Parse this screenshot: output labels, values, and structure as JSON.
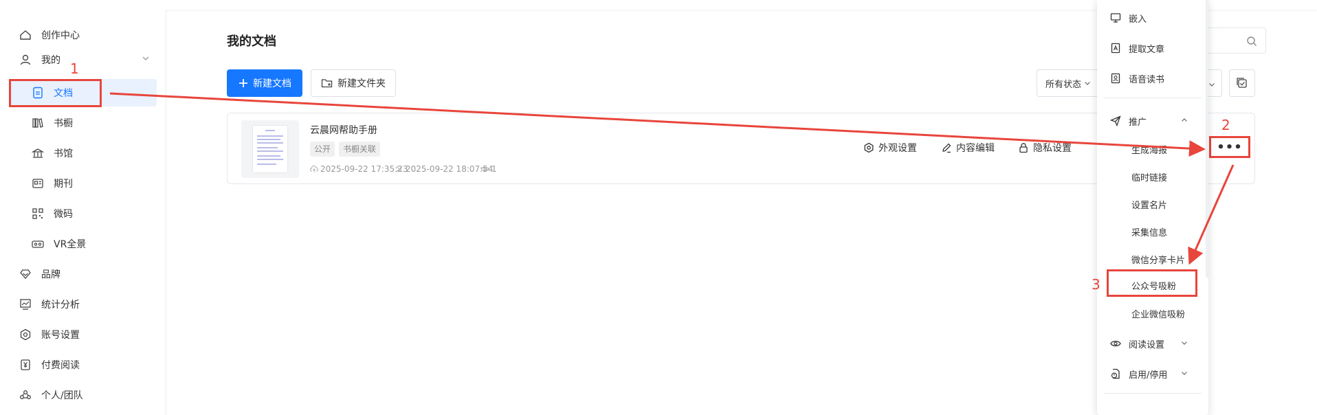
{
  "colors": {
    "accent": "#1677ff",
    "annotation": "#e8453c",
    "sidebar_active_bg": "#e8f1fd"
  },
  "sidebar": {
    "items": [
      {
        "label": "创作中心",
        "icon": "home-icon"
      },
      {
        "label": "我的",
        "icon": "user-icon"
      },
      {
        "label": "文档",
        "icon": "document-icon",
        "active": true
      },
      {
        "label": "书橱",
        "icon": "bookshelf-icon"
      },
      {
        "label": "书馆",
        "icon": "library-icon"
      },
      {
        "label": "期刊",
        "icon": "journal-icon"
      },
      {
        "label": "微码",
        "icon": "qrcode-icon"
      },
      {
        "label": "VR全景",
        "icon": "vr-icon"
      },
      {
        "label": "品牌",
        "icon": "brand-icon"
      },
      {
        "label": "统计分析",
        "icon": "chart-icon"
      },
      {
        "label": "账号设置",
        "icon": "settings-icon"
      },
      {
        "label": "付费阅读",
        "icon": "yen-icon"
      },
      {
        "label": "个人/团队",
        "icon": "team-icon"
      }
    ]
  },
  "main": {
    "title": "我的文档",
    "new_doc_label": "新建文档",
    "new_folder_label": "新建文件夹",
    "status_filter": "所有状态"
  },
  "document": {
    "title": "云晨网帮助手册",
    "tags": [
      "公开",
      "书橱关联"
    ],
    "created": "2025-09-22 17:35:23",
    "updated": "2025-09-22 18:07:54",
    "views": "1",
    "actions": [
      "外观设置",
      "内容编辑",
      "隐私设置"
    ],
    "more_label": "•••"
  },
  "dropdown": {
    "embed": "嵌入",
    "extract": "提取文章",
    "audio": "语音读书",
    "promote": "推广",
    "poster": "生成海报",
    "temp_link": "临时链接",
    "card": "设置名片",
    "collect": "采集信息",
    "wechat_card": "微信分享卡片",
    "mp_follow": "公众号吸粉",
    "work_wechat": "企业微信吸粉",
    "read_settings": "阅读设置",
    "enable_disable": "启用/停用"
  },
  "annotations": {
    "step1": "1",
    "step2": "2",
    "step3": "3"
  }
}
